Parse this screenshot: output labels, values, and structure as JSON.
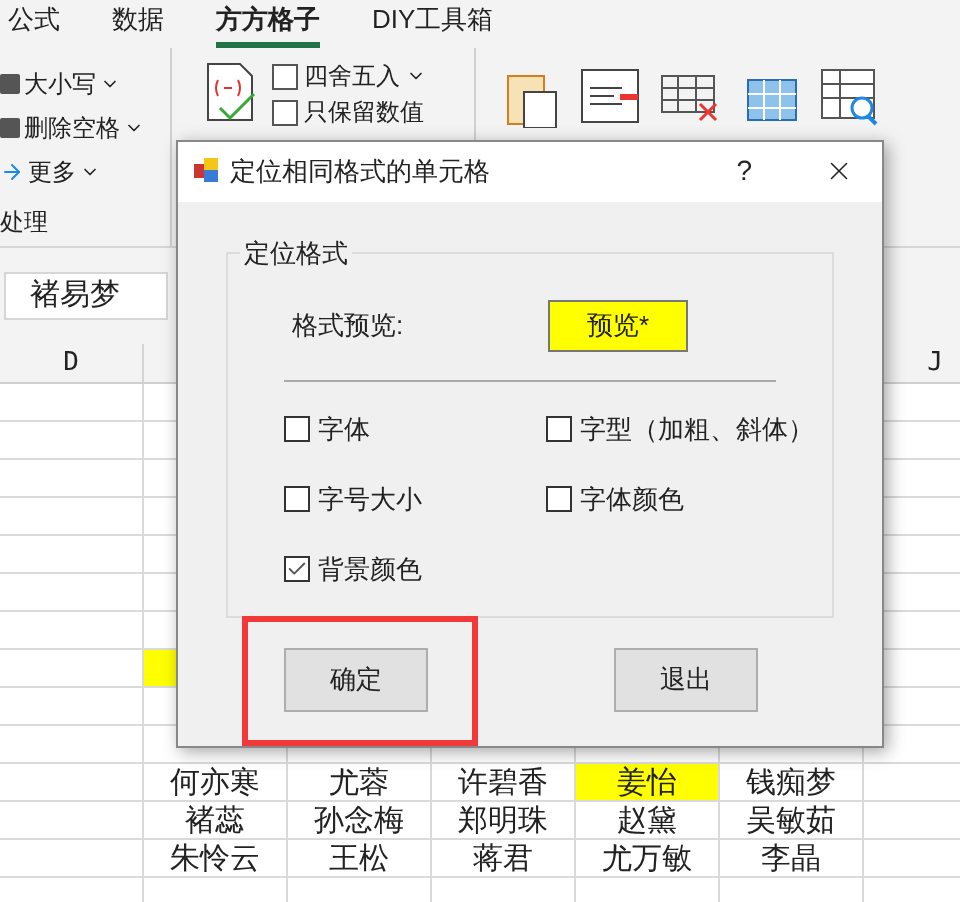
{
  "tabs": [
    {
      "label": "公式",
      "selected": false
    },
    {
      "label": "数据",
      "selected": false
    },
    {
      "label": "方方格子",
      "selected": true
    },
    {
      "label": "DIY工具箱",
      "selected": false
    }
  ],
  "ribbon": {
    "text_tools": [
      {
        "label": "大小写"
      },
      {
        "label": "删除空格"
      },
      {
        "label": "更多"
      }
    ],
    "group_label": "处理",
    "number_tools": [
      {
        "label": "四舍五入"
      },
      {
        "label": "只保留数值"
      }
    ]
  },
  "name_box": {
    "value": "褚易梦"
  },
  "column_headers": [
    "D",
    "J"
  ],
  "sheet_rows": [
    {
      "cells": [
        {
          "text": "",
          "highlighted": true
        }
      ]
    },
    {
      "cells": [
        {
          "text": "何亦寒",
          "highlighted": false
        },
        {
          "text": "尤蓉",
          "highlighted": false
        },
        {
          "text": "许碧香",
          "highlighted": false
        },
        {
          "text": "姜怡",
          "highlighted": true
        },
        {
          "text": "钱痴梦",
          "highlighted": false
        }
      ]
    },
    {
      "cells": [
        {
          "text": "褚蕊",
          "highlighted": false
        },
        {
          "text": "孙念梅",
          "highlighted": false
        },
        {
          "text": "郑明珠",
          "highlighted": false
        },
        {
          "text": "赵黛",
          "highlighted": false
        },
        {
          "text": "吴敏茹",
          "highlighted": false
        }
      ]
    },
    {
      "cells": [
        {
          "text": "朱怜云",
          "highlighted": false
        },
        {
          "text": "王松",
          "highlighted": false
        },
        {
          "text": "蒋君",
          "highlighted": false
        },
        {
          "text": "尤万敏",
          "highlighted": false
        },
        {
          "text": "李晶",
          "highlighted": false
        }
      ]
    }
  ],
  "dialog": {
    "title": "定位相同格式的单元格",
    "help": "?",
    "group_title": "定位格式",
    "preview_label": "格式预览:",
    "preview_value": "预览*",
    "options": [
      {
        "label": "字体",
        "checked": false
      },
      {
        "label": "字型（加粗、斜体）",
        "checked": false
      },
      {
        "label": "字号大小",
        "checked": false
      },
      {
        "label": "字体颜色",
        "checked": false
      },
      {
        "label": "背景颜色",
        "checked": true
      }
    ],
    "buttons": [
      {
        "label": "确定",
        "highlighted": true
      },
      {
        "label": "退出",
        "highlighted": false
      }
    ]
  }
}
